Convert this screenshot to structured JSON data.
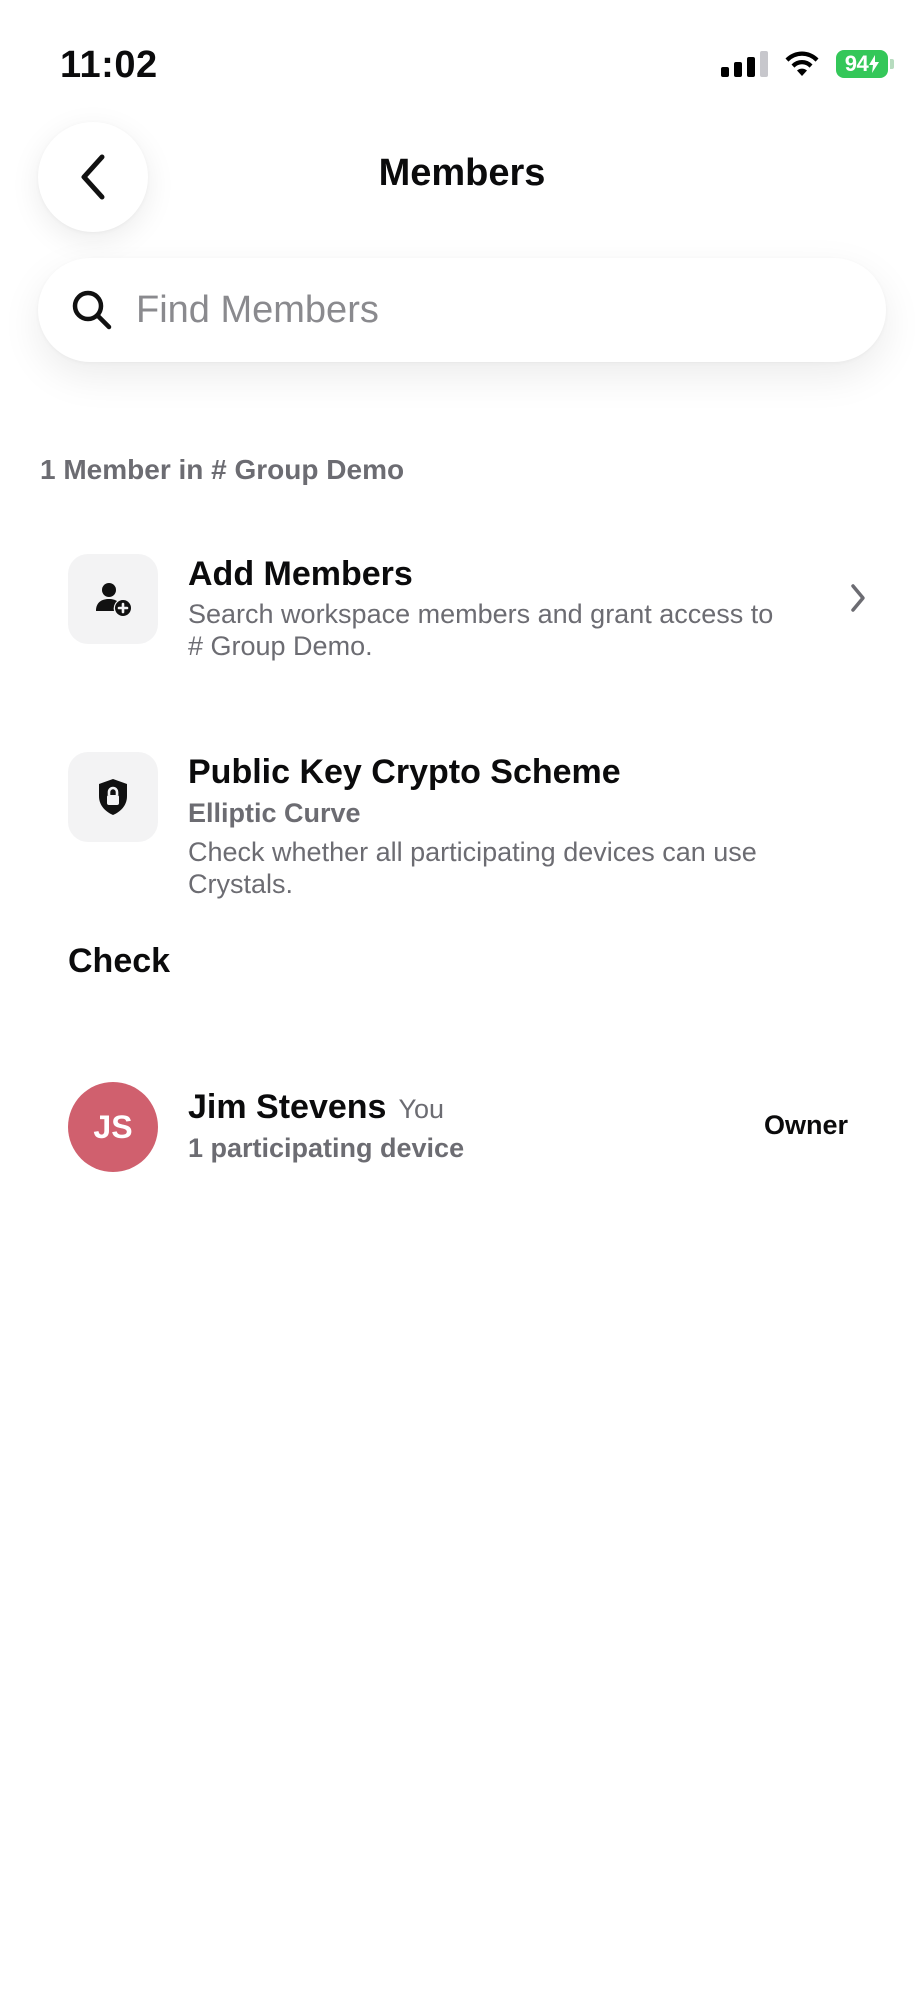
{
  "status_bar": {
    "time": "11:02",
    "battery": "94",
    "icons": [
      "signal-icon",
      "wifi-icon",
      "battery-charging-icon"
    ]
  },
  "header": {
    "title": "Members",
    "back_icon": "chevron-left-icon"
  },
  "search": {
    "placeholder": "Find Members",
    "value": "",
    "icon": "search-icon"
  },
  "section": {
    "label": "1 Member in # Group Demo"
  },
  "add_members": {
    "icon": "person-add-icon",
    "title": "Add Members",
    "description": "Search workspace members and grant access to # Group Demo.",
    "chevron_icon": "chevron-right-icon"
  },
  "crypto": {
    "icon": "shield-lock-icon",
    "title": "Public Key Crypto Scheme",
    "subtitle": "Elliptic Curve",
    "description": "Check whether all participating devices can use Crystals.",
    "action": "Check"
  },
  "members": [
    {
      "initials": "JS",
      "name": "Jim Stevens",
      "tag": "You",
      "devices": "1 participating device",
      "role": "Owner",
      "avatar_color": "#d0606e"
    }
  ],
  "colors": {
    "accent_battery": "#34c759",
    "secondary_text": "#6c6c72",
    "icon_tile": "#f3f3f4"
  }
}
